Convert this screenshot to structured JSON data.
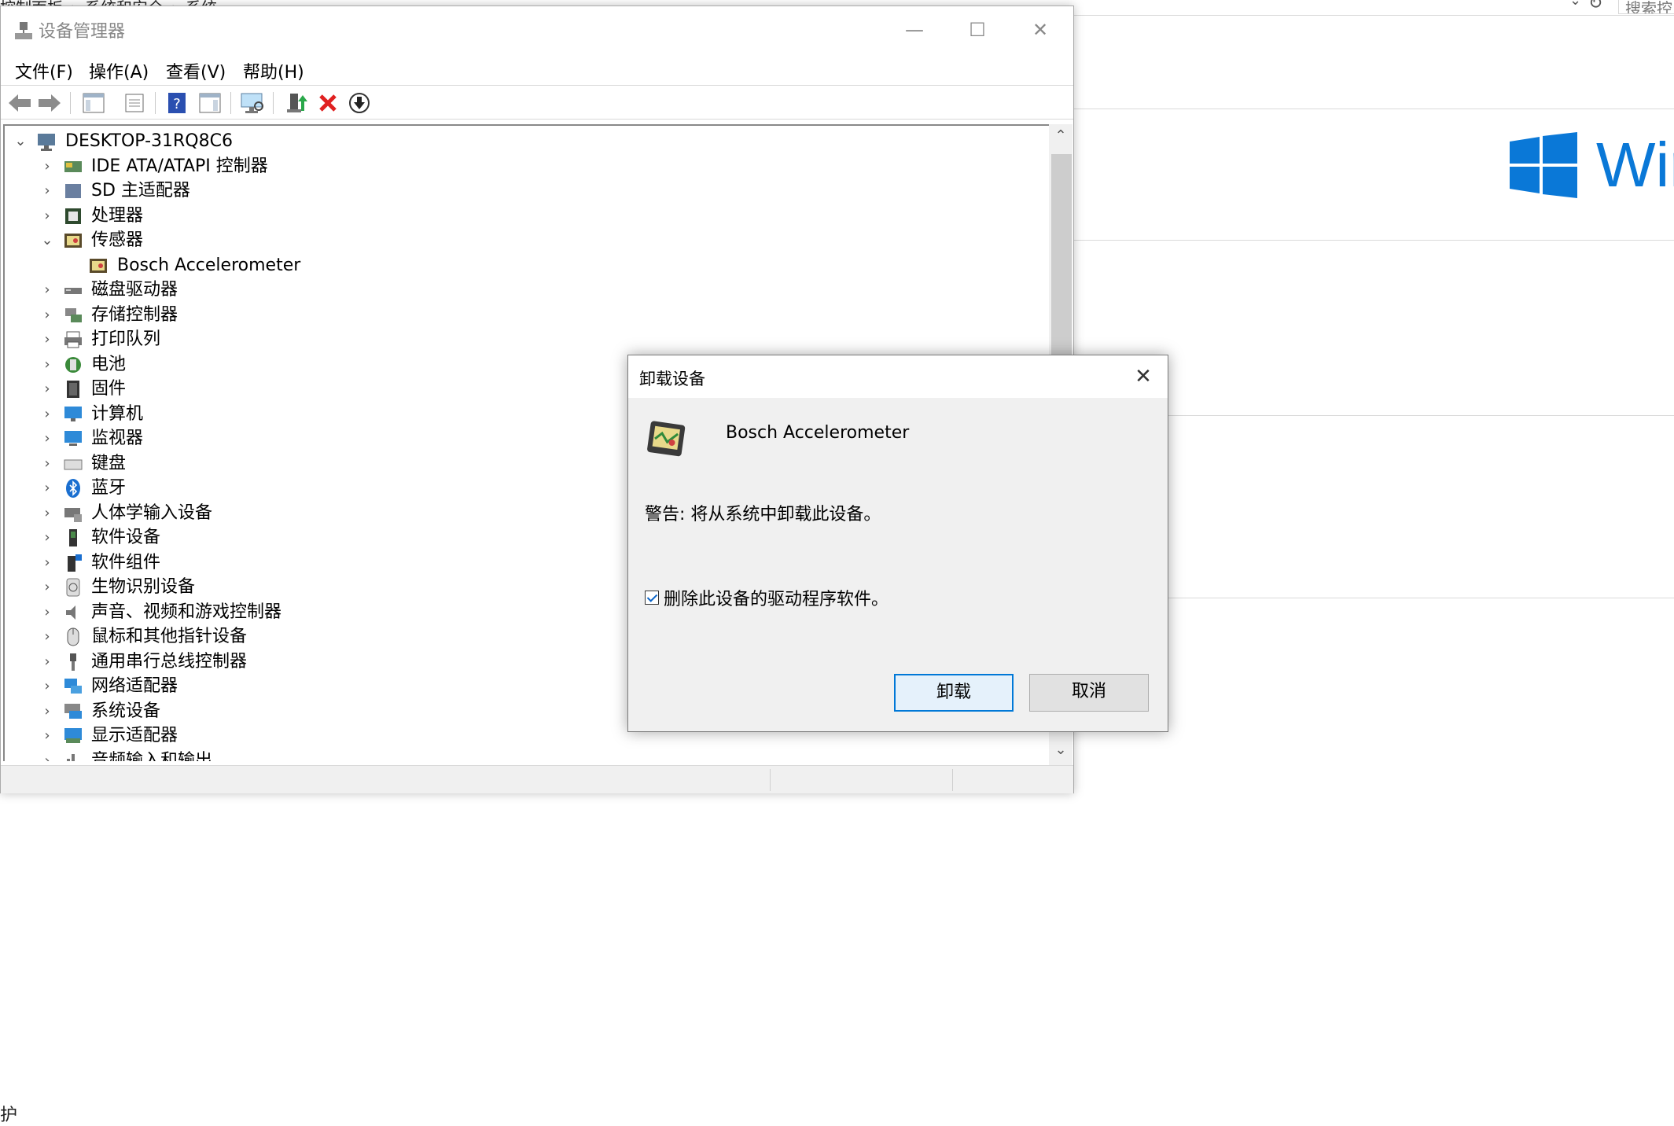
{
  "background": {
    "breadcrumb": [
      "控制面板",
      "系统和安全",
      "系统"
    ],
    "search_placeholder": "搜索控",
    "brand_text": "Wir",
    "bottom_text": "护",
    "brand_color": "#0a78d7"
  },
  "device_manager": {
    "title": "设备管理器",
    "menu": [
      "文件(F)",
      "操作(A)",
      "查看(V)",
      "帮助(H)"
    ],
    "toolbar_icons": [
      "back-icon",
      "forward-icon",
      "show-hide-tree-icon",
      "properties-icon",
      "help-icon",
      "action-pane-icon",
      "scan-hardware-icon",
      "update-driver-icon",
      "uninstall-device-icon",
      "disable-device-icon"
    ],
    "tree": {
      "root": "DESKTOP-31RQ8C6",
      "items": [
        {
          "label": "IDE ATA/ATAPI 控制器",
          "icon": "ide-controller-icon",
          "expanded": false
        },
        {
          "label": "SD 主适配器",
          "icon": "sd-host-icon",
          "expanded": false
        },
        {
          "label": "处理器",
          "icon": "processor-icon",
          "expanded": false
        },
        {
          "label": "传感器",
          "icon": "sensor-icon",
          "expanded": true
        },
        {
          "label": "Bosch Accelerometer",
          "icon": "sensor-icon",
          "child": true
        },
        {
          "label": "磁盘驱动器",
          "icon": "disk-drive-icon",
          "expanded": false
        },
        {
          "label": "存储控制器",
          "icon": "storage-controller-icon",
          "expanded": false
        },
        {
          "label": "打印队列",
          "icon": "printer-icon",
          "expanded": false
        },
        {
          "label": "电池",
          "icon": "battery-icon",
          "expanded": false
        },
        {
          "label": "固件",
          "icon": "firmware-icon",
          "expanded": false
        },
        {
          "label": "计算机",
          "icon": "computer-icon",
          "expanded": false
        },
        {
          "label": "监视器",
          "icon": "monitor-icon",
          "expanded": false
        },
        {
          "label": "键盘",
          "icon": "keyboard-icon",
          "expanded": false
        },
        {
          "label": "蓝牙",
          "icon": "bluetooth-icon",
          "expanded": false
        },
        {
          "label": "人体学输入设备",
          "icon": "hid-icon",
          "expanded": false
        },
        {
          "label": "软件设备",
          "icon": "software-device-icon",
          "expanded": false
        },
        {
          "label": "软件组件",
          "icon": "software-component-icon",
          "expanded": false
        },
        {
          "label": "生物识别设备",
          "icon": "biometric-icon",
          "expanded": false
        },
        {
          "label": "声音、视频和游戏控制器",
          "icon": "sound-icon",
          "expanded": false
        },
        {
          "label": "鼠标和其他指针设备",
          "icon": "mouse-icon",
          "expanded": false
        },
        {
          "label": "通用串行总线控制器",
          "icon": "usb-icon",
          "expanded": false
        },
        {
          "label": "网络适配器",
          "icon": "network-adapter-icon",
          "expanded": false
        },
        {
          "label": "系统设备",
          "icon": "system-device-icon",
          "expanded": false
        },
        {
          "label": "显示适配器",
          "icon": "display-adapter-icon",
          "expanded": false
        },
        {
          "label": "音频输入和输出",
          "icon": "audio-io-icon",
          "expanded": false
        }
      ]
    }
  },
  "dialog": {
    "title": "卸载设备",
    "device_name": "Bosch Accelerometer",
    "warning": "警告: 将从系统中卸载此设备。",
    "checkbox_label": "删除此设备的驱动程序软件。",
    "checkbox_checked": true,
    "uninstall_button": "卸载",
    "cancel_button": "取消"
  }
}
